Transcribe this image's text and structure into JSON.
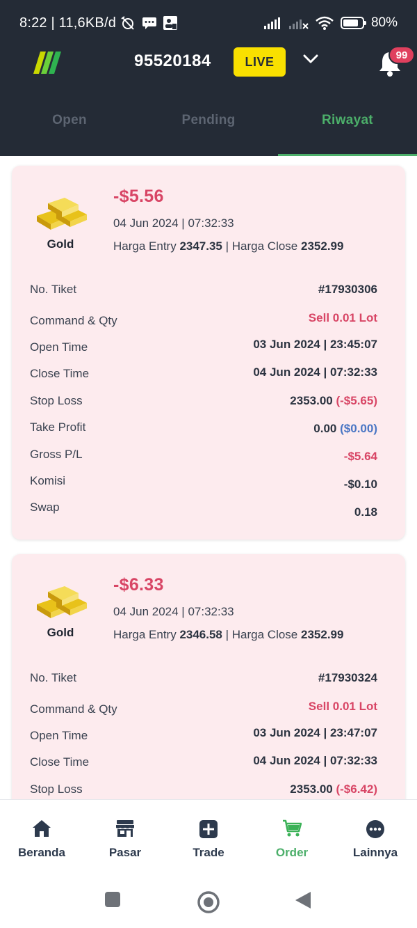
{
  "status_bar": {
    "time_speed": "8:22 | 11,6KB/d",
    "battery": "80%",
    "battery_level": 0.8
  },
  "header": {
    "account_number": "95520184",
    "mode_badge": "LIVE",
    "notification_count": "99"
  },
  "tabs": [
    {
      "label": "Open",
      "active": false
    },
    {
      "label": "Pending",
      "active": false
    },
    {
      "label": "Riwayat",
      "active": true
    }
  ],
  "orders": [
    {
      "asset": "Gold",
      "pnl": "-$5.56",
      "datetime": "04 Jun 2024 | 07:32:33",
      "entry_label": "Harga Entry",
      "entry_price": "2347.35",
      "separator": " | ",
      "close_label": "Harga Close",
      "close_price": "2352.99",
      "details": [
        {
          "label": "No. Tiket",
          "value": "#17930306"
        },
        {
          "label": "Command & Qty",
          "value": "Sell 0.01 Lot"
        },
        {
          "label": "Open Time",
          "value": "03 Jun 2024 | 23:45:07"
        },
        {
          "label": "Close Time",
          "value": "04 Jun 2024 | 07:32:33"
        },
        {
          "label": "Stop Loss",
          "value": "2353.00",
          "extra": "(-$5.65)"
        },
        {
          "label": "Take Profit",
          "value": "0.00",
          "extra": "($0.00)"
        },
        {
          "label": "Gross P/L",
          "value": "-$5.64"
        },
        {
          "label": "Komisi",
          "value": "-$0.10"
        },
        {
          "label": "Swap",
          "value": "0.18"
        }
      ]
    },
    {
      "asset": "Gold",
      "pnl": "-$6.33",
      "datetime": "04 Jun 2024 | 07:32:33",
      "entry_label": "Harga Entry",
      "entry_price": "2346.58",
      "separator": " | ",
      "close_label": "Harga Close",
      "close_price": "2352.99",
      "details": [
        {
          "label": "No. Tiket",
          "value": "#17930324"
        },
        {
          "label": "Command & Qty",
          "value": "Sell 0.01 Lot"
        },
        {
          "label": "Open Time",
          "value": "03 Jun 2024 | 23:47:07"
        },
        {
          "label": "Close Time",
          "value": "04 Jun 2024 | 07:32:33"
        },
        {
          "label": "Stop Loss",
          "value": "2353.00",
          "extra": "(-$6.42)"
        }
      ]
    }
  ],
  "bottom_nav": [
    {
      "label": "Beranda",
      "icon": "home-icon",
      "active": false
    },
    {
      "label": "Pasar",
      "icon": "store-icon",
      "active": false
    },
    {
      "label": "Trade",
      "icon": "plus-square-icon",
      "active": false
    },
    {
      "label": "Order",
      "icon": "cart-icon",
      "active": true
    },
    {
      "label": "Lainnya",
      "icon": "more-icon",
      "active": false
    }
  ],
  "colors": {
    "header_bg": "#242b36",
    "accent_green": "#4caf6a",
    "loss_red": "#d84565",
    "card_bg": "#fdebee",
    "live_yellow": "#f9e000"
  }
}
